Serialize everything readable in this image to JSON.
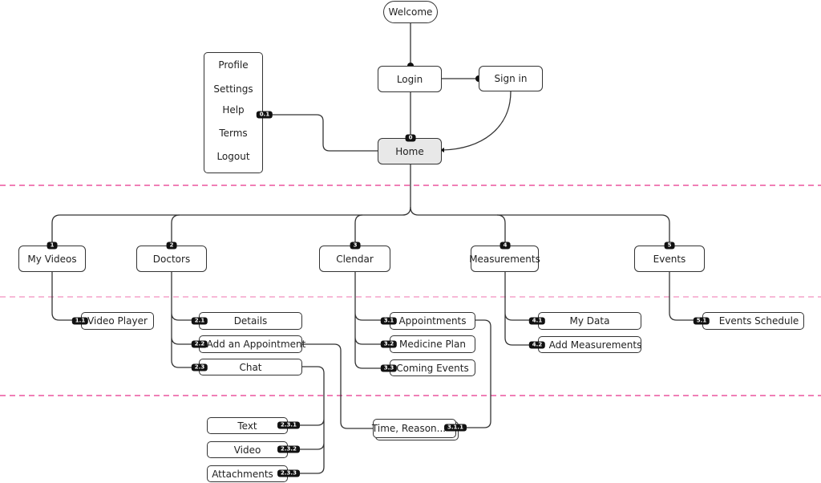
{
  "colors": {
    "divider": "#e8338a",
    "home_fill": "#e8e8e8",
    "badge": "#111111"
  },
  "top": {
    "welcome": "Welcome",
    "login": "Login",
    "sign_in": "Sign in",
    "home": "Home",
    "home_badge": "0",
    "menu_badge": "0.1",
    "menu": [
      "Profile",
      "Settings",
      "Help",
      "Terms",
      "Logout"
    ]
  },
  "sections": [
    {
      "label": "My Videos",
      "badge": "1",
      "children": [
        {
          "label": "Video Player",
          "badge": "1.1"
        }
      ]
    },
    {
      "label": "Doctors",
      "badge": "2",
      "children": [
        {
          "label": "Details",
          "badge": "2.1"
        },
        {
          "label": "Add an Appointment",
          "badge": "2.2"
        },
        {
          "label": "Chat",
          "badge": "2.3",
          "children": [
            {
              "label": "Text",
              "badge": "2.3.1"
            },
            {
              "label": "Video",
              "badge": "2.3.2"
            },
            {
              "label": "Attachments",
              "badge": "2.3.3"
            }
          ]
        }
      ]
    },
    {
      "label": "Clendar",
      "badge": "3",
      "children": [
        {
          "label": "Appointments",
          "badge": "3.1",
          "children": [
            {
              "label": "Time, Reason...",
              "badge": "3.1.1"
            }
          ]
        },
        {
          "label": "Medicine Plan",
          "badge": "3.2"
        },
        {
          "label": "Coming Events",
          "badge": "3.3"
        }
      ]
    },
    {
      "label": "Measurements",
      "badge": "4",
      "children": [
        {
          "label": "My Data",
          "badge": "4.1"
        },
        {
          "label": "Add Measurements",
          "badge": "4.2"
        }
      ]
    },
    {
      "label": "Events",
      "badge": "5",
      "children": [
        {
          "label": "Events Schedule",
          "badge": "5.1"
        }
      ]
    }
  ]
}
